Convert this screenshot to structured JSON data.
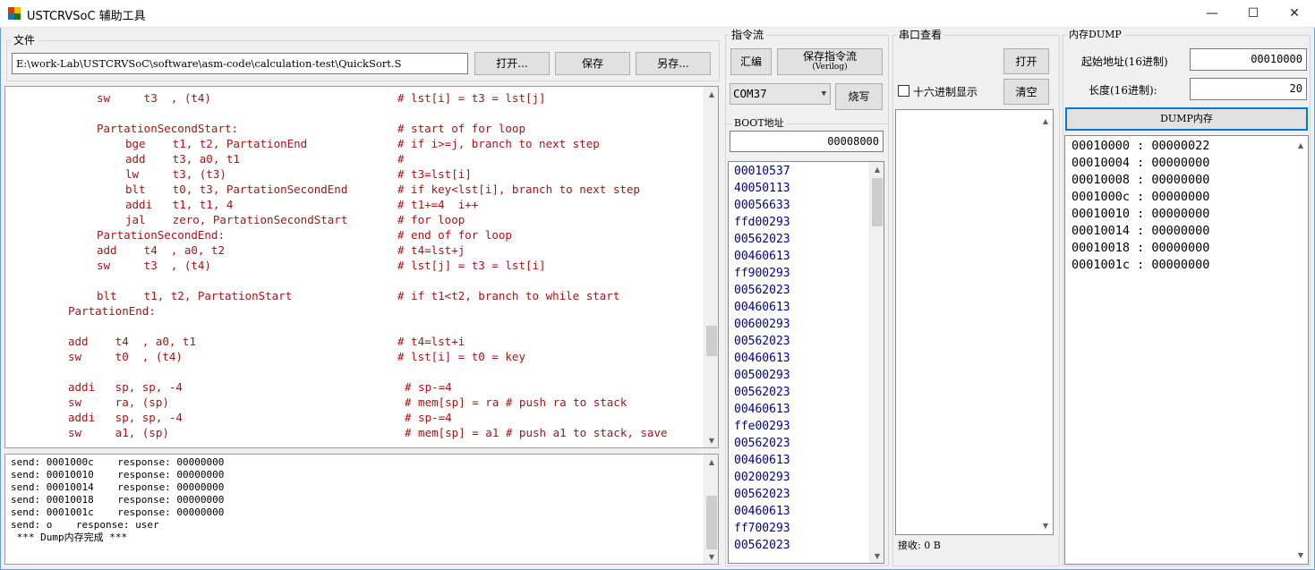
{
  "window": {
    "title": "USTCRVSoC 辅助工具",
    "minimize_glyph": "—",
    "maximize_glyph": "☐",
    "close_glyph": "✕",
    "app_icon": "app-icon"
  },
  "file_group": {
    "label": "文件",
    "path": "E:\\work-Lab\\USTCRVSoC\\software\\asm-code\\calculation-test\\QuickSort.S",
    "open_label": "打开...",
    "save_label": "保存",
    "save_as_label": "另存..."
  },
  "code_lines": [
    {
      "instr": "sw     t3  , (t4)",
      "comment": "# lst[i] = t3 = lst[j]"
    },
    {
      "instr": "",
      "comment": ""
    },
    {
      "instr": "PartationSecondStart:",
      "comment": "# start of for loop"
    },
    {
      "instr": "bge    t1, t2, PartationEnd",
      "comment": "# if i>=j, branch to next step"
    },
    {
      "instr": "add    t3, a0, t1",
      "comment": "#"
    },
    {
      "instr": "lw     t3, (t3)",
      "comment": "# t3=lst[i]"
    },
    {
      "instr": "blt    t0, t3, PartationSecondEnd",
      "comment": "# if key<lst[i], branch to next step"
    },
    {
      "instr": "addi   t1, t1, 4",
      "comment": "# t1+=4  i++"
    },
    {
      "instr": "jal    zero, PartationSecondStart",
      "comment": "# for loop"
    },
    {
      "instr": "PartationSecondEnd:",
      "comment": "# end of for loop"
    },
    {
      "instr": "add    t4  , a0, t2",
      "comment": "# t4=lst+j"
    },
    {
      "instr": "sw     t3  , (t4)",
      "comment": "# lst[j] = t3 = lst[i]"
    },
    {
      "instr": "",
      "comment": ""
    },
    {
      "instr": "blt    t1, t2, PartationStart",
      "comment": "# if t1<t2, branch to while start"
    },
    {
      "instr": "PartationEnd:",
      "comment": ""
    },
    {
      "instr": "",
      "comment": ""
    },
    {
      "instr": "add    t4  , a0, t1",
      "comment": "# t4=lst+i"
    },
    {
      "instr": "sw     t0  , (t4)",
      "comment": "# lst[i] = t0 = key"
    },
    {
      "instr": "",
      "comment": ""
    },
    {
      "instr": "addi   sp, sp, -4",
      "comment": "# sp-=4"
    },
    {
      "instr": "sw     ra, (sp)",
      "comment": "# mem[sp] = ra # push ra to stack"
    },
    {
      "instr": "addi   sp, sp, -4",
      "comment": "# sp-=4"
    },
    {
      "instr": "sw     a1, (sp)",
      "comment": "# mem[sp] = a1 # push a1 to stack, save"
    }
  ],
  "log_lines": [
    "send: 0001000c    response: 00000000",
    "send: 00010010    response: 00000000",
    "send: 00010014    response: 00000000",
    "send: 00010018    response: 00000000",
    "send: 0001001c    response: 00000000",
    "send: o    response: user",
    " *** Dump内存完成 ***"
  ],
  "instruction_stream": {
    "label": "指令流",
    "assemble_label": "汇编",
    "save_stream_label": "保存指令流",
    "save_stream_sub": "(Verilog)",
    "com_port": "COM37",
    "burn_label": "烧写",
    "boot_label": "BOOT地址",
    "boot_address": "00008000",
    "instructions": [
      "00010537",
      "40050113",
      "00056633",
      "ffd00293",
      "00562023",
      "00460613",
      "ff900293",
      "00562023",
      "00460613",
      "00600293",
      "00562023",
      "00460613",
      "00500293",
      "00562023",
      "00460613",
      "ffe00293",
      "00562023",
      "00460613",
      "00200293",
      "00562023",
      "00460613",
      "ff700293",
      "00562023"
    ]
  },
  "serial": {
    "label": "串口查看",
    "open_label": "打开",
    "hex_label": "十六进制显示",
    "clear_label": "清空",
    "received": "接收: 0 B"
  },
  "memory_dump": {
    "label": "内存DUMP",
    "start_label": "起始地址(16进制)",
    "start_value": "00010000",
    "length_label": "长度(16进制):",
    "length_value": "20",
    "dump_button": "DUMP内存",
    "rows": [
      "00010000 : 00000022",
      "00010004 : 00000000",
      "00010008 : 00000000",
      "0001000c : 00000000",
      "00010010 : 00000000",
      "00010014 : 00000000",
      "00010018 : 00000000",
      "0001001c : 00000000"
    ]
  },
  "scroll_glyphs": {
    "up": "▲",
    "down": "▼"
  },
  "colors": {
    "code_text": "#a31515",
    "instr_text": "#00008b",
    "focus_border": "#0078d7"
  }
}
